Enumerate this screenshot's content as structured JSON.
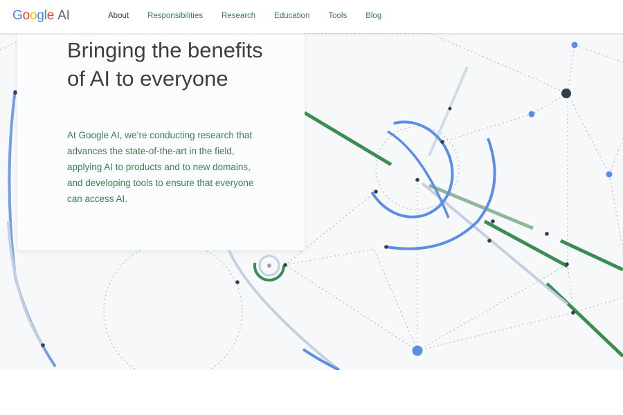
{
  "brand": {
    "logo_letters": [
      "G",
      "o",
      "o",
      "g",
      "l",
      "e"
    ],
    "logo_suffix": "AI",
    "colors": {
      "blue": "#4285f4",
      "red": "#ea4335",
      "yellow": "#fbbc05",
      "green": "#34a853"
    }
  },
  "nav": {
    "items": [
      {
        "label": "About",
        "active": true
      },
      {
        "label": "Responsibilities"
      },
      {
        "label": "Research"
      },
      {
        "label": "Education"
      },
      {
        "label": "Tools"
      },
      {
        "label": "Blog"
      }
    ]
  },
  "hero": {
    "title": "Bringing the benefits of AI to everyone",
    "description": "At Google AI, we’re conducting research that advances the state-of-the-art in the field, applying AI to products and to new domains, and developing tools to ensure that everyone can access AI."
  },
  "theme": {
    "nav_link_color": "#3c7f4f",
    "heading_color": "#3c4043",
    "line_green": "#3c8c54",
    "line_blue": "#5c8ee6",
    "dot_dark": "#333d4b"
  }
}
